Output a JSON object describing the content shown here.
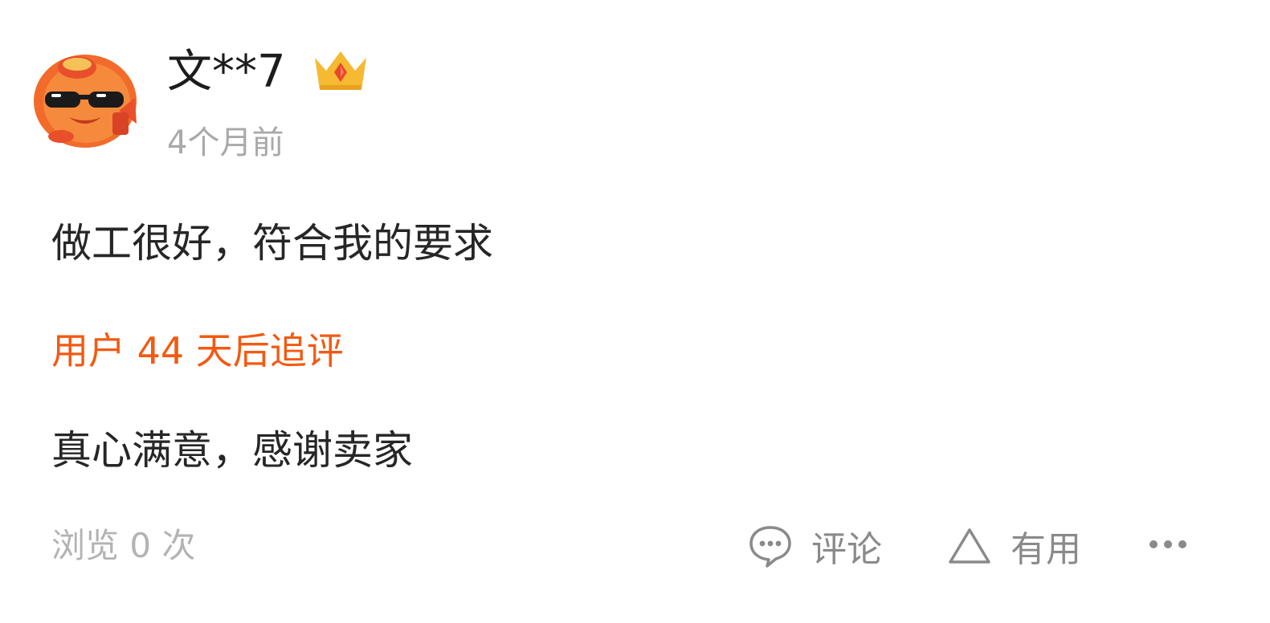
{
  "review": {
    "username": "文**7",
    "time": "4个月前",
    "content": "做工很好，符合我的要求",
    "followup_label": "用户 44 天后追评",
    "followup_content": "真心满意，感谢卖家",
    "views": "浏览 0 次"
  },
  "actions": {
    "comment_label": "评论",
    "useful_label": "有用"
  },
  "icons": {
    "avatar": "cartoon-sunglasses-avatar",
    "badge": "crown-icon",
    "comment": "comment-bubble-icon",
    "useful": "triangle-icon",
    "more": "ellipsis-icon"
  },
  "colors": {
    "followup_accent": "#f25a12",
    "crown_gold": "#f5b932",
    "crown_gem": "#e8472a"
  }
}
